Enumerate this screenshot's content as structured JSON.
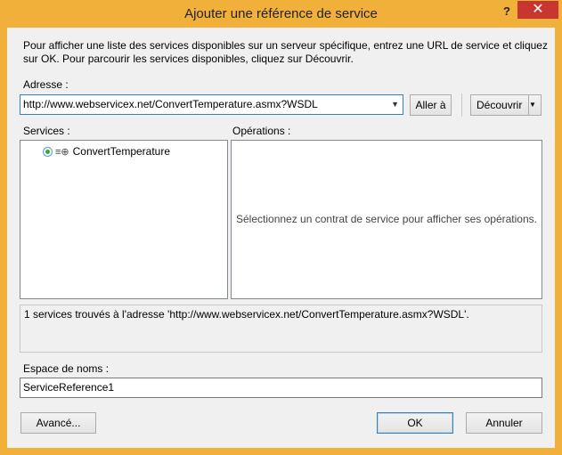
{
  "window": {
    "title": "Ajouter une référence de service",
    "help_label": "?",
    "close_label": "✕"
  },
  "intro_text": "Pour afficher une liste des services disponibles sur un serveur spécifique, entrez une URL de service et cliquez sur OK. Pour parcourir les services disponibles, cliquez sur Découvrir.",
  "address": {
    "label": "Adresse :",
    "value": "http://www.webservicex.net/ConvertTemperature.asmx?WSDL",
    "go_button": "Aller à",
    "discover_button": "Découvrir"
  },
  "services": {
    "label": "Services :",
    "items": [
      {
        "label": "ConvertTemperature",
        "expanded": false
      }
    ]
  },
  "operations": {
    "label": "Opérations :",
    "empty_text": "Sélectionnez un contrat de service pour afficher ses opérations."
  },
  "status_text": "1 services trouvés à l'adresse 'http://www.webservicex.net/ConvertTemperature.asmx?WSDL'.",
  "namespace": {
    "label": "Espace de noms :",
    "value": "ServiceReference1"
  },
  "buttons": {
    "advanced": "Avancé...",
    "ok": "OK",
    "cancel": "Annuler"
  },
  "colors": {
    "title_bar": "#f0b03a",
    "close_button": "#c7372f",
    "focus_border": "#3c7fb1"
  }
}
